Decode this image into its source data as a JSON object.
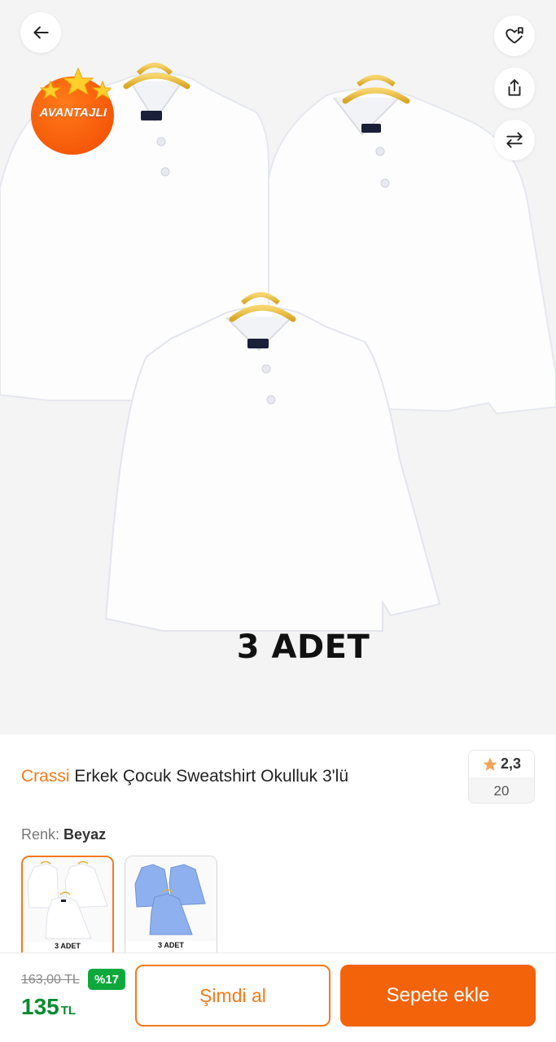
{
  "hero": {
    "badge_text": "AVANTAJLI",
    "pack_label": "3 ADET",
    "icons": {
      "back": "arrow-left-icon",
      "favorite": "heart-bookmark-icon",
      "share": "share-icon",
      "compare": "swap-arrows-icon"
    }
  },
  "product": {
    "brand": "Crassi",
    "name": "Erkek Çocuk Sweatshirt Okulluk 3'lü",
    "rating": "2,3",
    "review_count": "20"
  },
  "color": {
    "label": "Renk:",
    "value": "Beyaz",
    "variants": [
      {
        "label": "3 ADET",
        "color": "#ffffff",
        "selected": true
      },
      {
        "label": "3 ADET",
        "color": "#8fb0ee",
        "selected": false
      }
    ]
  },
  "purchase": {
    "old_price": "163,00 TL",
    "discount": "%17",
    "price": "135",
    "currency": "TL",
    "buy_now_label": "Şimdi al",
    "add_to_cart_label": "Sepete ekle"
  },
  "colors": {
    "accent": "#f27a1a",
    "cart_button": "#f2630a",
    "price_green": "#0a8a32",
    "discount_badge": "#0fa83c"
  }
}
